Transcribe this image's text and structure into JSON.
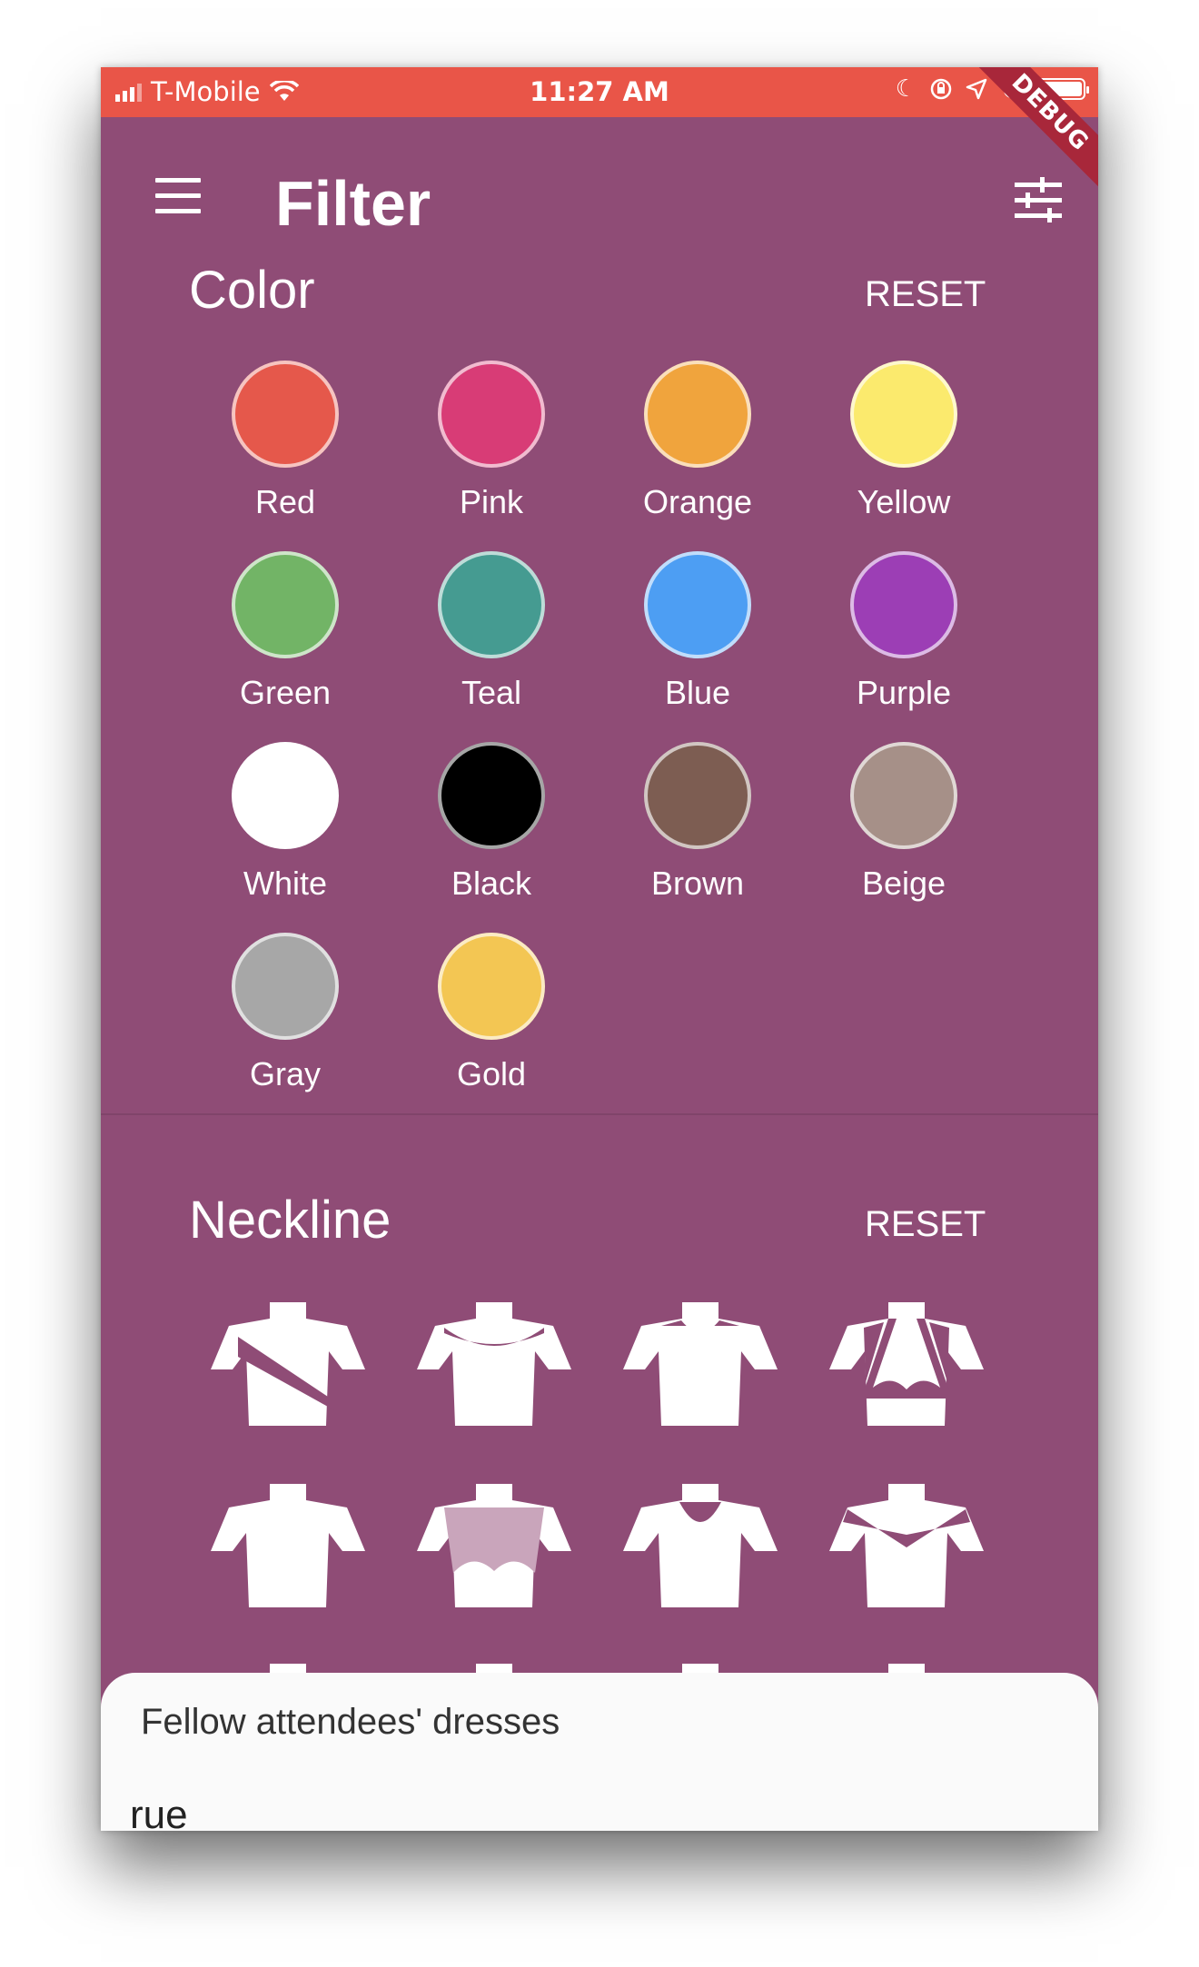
{
  "status_bar": {
    "carrier": "T-Mobile",
    "time": "11:27 AM",
    "icons": [
      "signal-icon",
      "wifi-icon",
      "moon-icon",
      "orientation-lock-icon",
      "location-icon",
      "alarm-icon",
      "battery-icon"
    ]
  },
  "app_bar": {
    "title": "Filter",
    "menu_icon": "menu-icon",
    "action_icon": "tune-icon",
    "debug_banner": "DEBUG"
  },
  "color_section": {
    "title": "Color",
    "reset_label": "RESET",
    "colors": [
      {
        "label": "Red",
        "hex": "#e5584b"
      },
      {
        "label": "Pink",
        "hex": "#d83c76"
      },
      {
        "label": "Orange",
        "hex": "#f0a43d"
      },
      {
        "label": "Yellow",
        "hex": "#fbea6d"
      },
      {
        "label": "Green",
        "hex": "#72b466"
      },
      {
        "label": "Teal",
        "hex": "#459b91"
      },
      {
        "label": "Blue",
        "hex": "#4d9ef3"
      },
      {
        "label": "Purple",
        "hex": "#9c3eb5"
      },
      {
        "label": "White",
        "hex": "#ffffff"
      },
      {
        "label": "Black",
        "hex": "#000000"
      },
      {
        "label": "Brown",
        "hex": "#7d5d52"
      },
      {
        "label": "Beige",
        "hex": "#a69088"
      },
      {
        "label": "Gray",
        "hex": "#a7a7a7"
      },
      {
        "label": "Gold",
        "hex": "#f3c653"
      }
    ]
  },
  "neckline_section": {
    "title": "Neckline",
    "reset_label": "RESET",
    "items": [
      "one-shoulder-neckline-icon",
      "scoop-neckline-icon",
      "high-round-neckline-icon",
      "halter-sweetheart-neckline-icon",
      "high-neck-neckline-icon",
      "illusion-sweetheart-neckline-icon",
      "round-neckline-icon",
      "off-shoulder-neckline-icon"
    ]
  },
  "bottom_sheet": {
    "title": "Fellow attendees' dresses",
    "text": "rue"
  },
  "colors": {
    "background": "#8f4c76",
    "status_bar": "#e95548",
    "debug_banner": "#a8273a",
    "sheet": "#fafafa"
  }
}
